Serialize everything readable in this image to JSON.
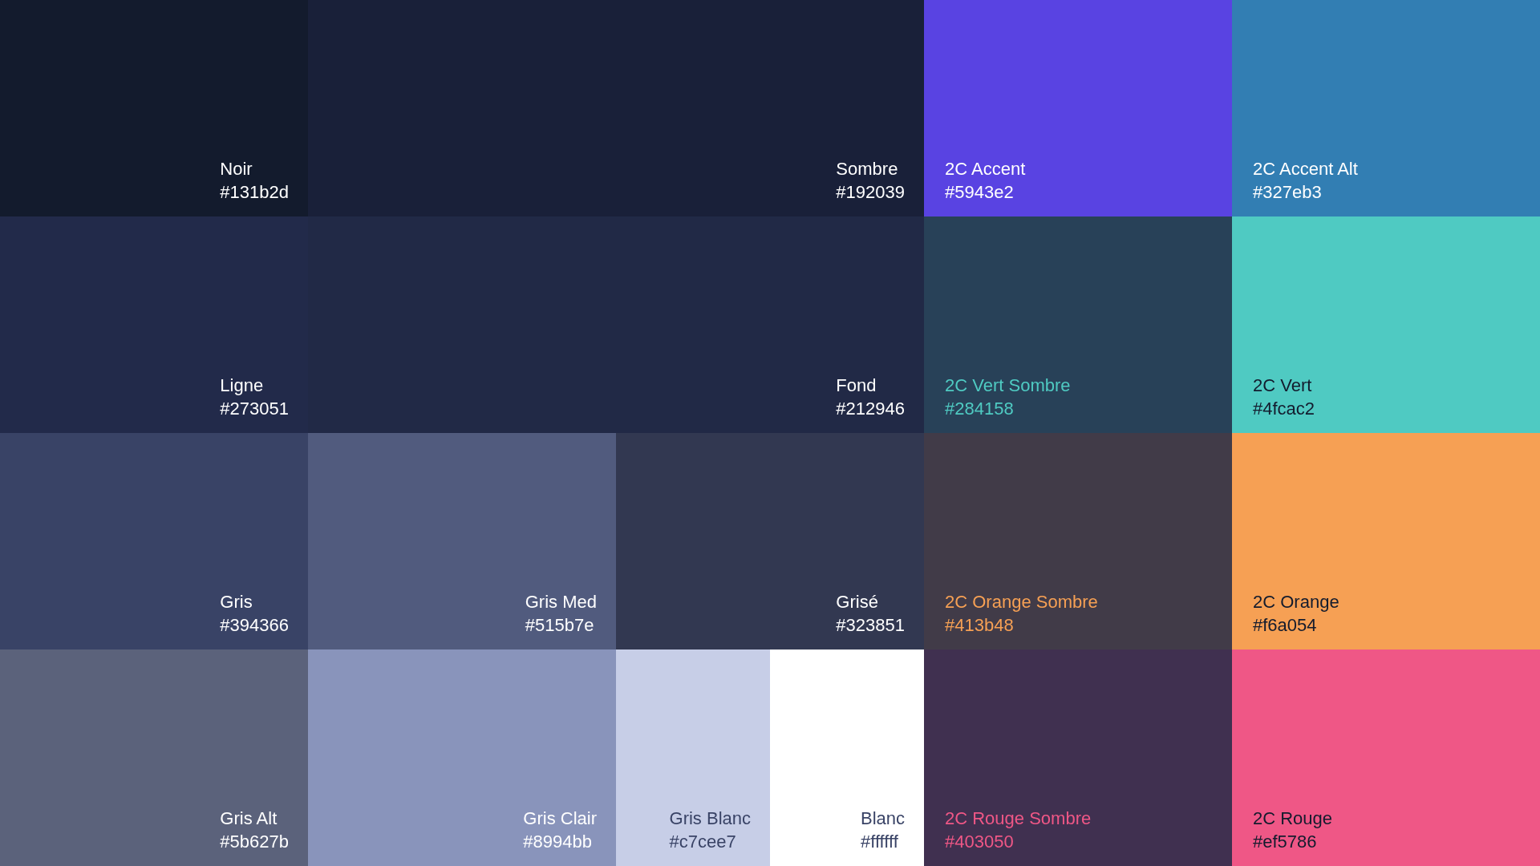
{
  "swatches": [
    {
      "name": "Noir",
      "hex": "#131b2d",
      "color": "#131b2d",
      "kind": "dark"
    },
    {
      "name": "Sombre",
      "hex": "#192039",
      "color": "#192039",
      "kind": "dark"
    },
    {
      "name": "2C Accent",
      "hex": "#5943e2",
      "color": "#5943e2",
      "kind": "dark"
    },
    {
      "name": "2C Accent Alt",
      "hex": "#327eb3",
      "color": "#327eb3",
      "kind": "dark"
    },
    {
      "name": "Ligne",
      "hex": "#273051",
      "color": "#222a4a",
      "kind": "dark"
    },
    {
      "name": "Fond",
      "hex": "#212946",
      "color": "#212946",
      "kind": "dark"
    },
    {
      "name": "2C Vert Sombre",
      "hex": "#284158",
      "color": "#284158",
      "kind": "tinted"
    },
    {
      "name": "2C Vert",
      "hex": "#4fcac2",
      "color": "#4fcac2",
      "kind": "bright"
    },
    {
      "name": "Gris",
      "hex": "#394366",
      "color": "#394366",
      "kind": "dark"
    },
    {
      "name": "Gris Med",
      "hex": "#515b7e",
      "color": "#515b7e",
      "kind": "dark"
    },
    {
      "name": "Grisé",
      "hex": "#323851",
      "color": "#323851",
      "kind": "dark"
    },
    {
      "name": "2C Orange Sombre",
      "hex": "#413b48",
      "color": "#413b48",
      "kind": "tinted"
    },
    {
      "name": "2C Orange",
      "hex": "#f6a054",
      "color": "#f6a054",
      "kind": "bright"
    },
    {
      "name": "Gris Alt",
      "hex": "#5b627b",
      "color": "#5b627b",
      "kind": "dark"
    },
    {
      "name": "Gris Clair",
      "hex": "#8994bb",
      "color": "#8994bb",
      "kind": "dark"
    },
    {
      "name": "Gris Blanc",
      "hex": "#c7cee7",
      "color": "#c7cee7",
      "kind": "pale"
    },
    {
      "name": "Blanc",
      "hex": "#ffffff",
      "color": "#ffffff",
      "kind": "pale"
    },
    {
      "name": "2C Rouge Sombre",
      "hex": "#403050",
      "color": "#403050",
      "kind": "tinted"
    },
    {
      "name": "2C Rouge",
      "hex": "#ef5786",
      "color": "#ef5786",
      "kind": "bright"
    }
  ]
}
